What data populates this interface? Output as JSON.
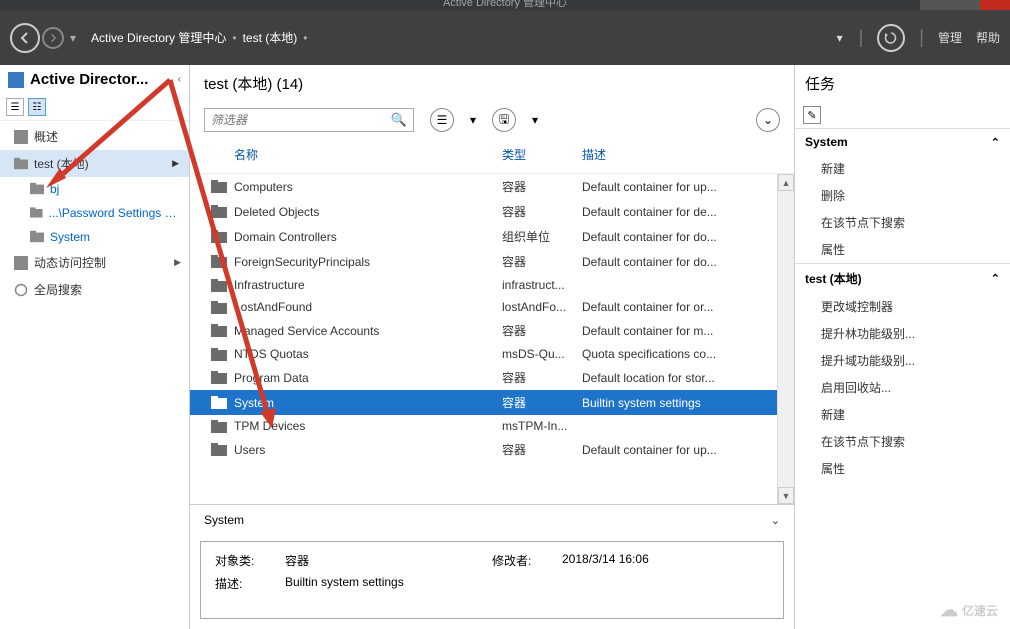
{
  "window_title": "Active Directory 管理中心",
  "header": {
    "breadcrumb": [
      "Active Directory 管理中心",
      "test (本地)"
    ],
    "manage": "管理",
    "help": "帮助"
  },
  "sidebar": {
    "title": "Active Director...",
    "items": [
      {
        "label": "概述",
        "plain": true
      },
      {
        "label": "test (本地)",
        "selected": true,
        "plain": true
      },
      {
        "label": "bj",
        "child": true
      },
      {
        "label": "...\\Password Settings Con...",
        "child": true,
        "truncate": true
      },
      {
        "label": "System",
        "child": true
      },
      {
        "label": "动态访问控制",
        "expandable": true,
        "plain": true
      },
      {
        "label": "全局搜索",
        "plain": true
      }
    ]
  },
  "center": {
    "title": "test (本地)  (14)",
    "filter_placeholder": "筛选器",
    "columns": {
      "name": "名称",
      "type": "类型",
      "desc": "描述"
    },
    "rows": [
      {
        "name": "Computers",
        "type": "容器",
        "desc": "Default container for up..."
      },
      {
        "name": "Deleted Objects",
        "type": "容器",
        "desc": "Default container for de..."
      },
      {
        "name": "Domain Controllers",
        "type": "组织单位",
        "desc": "Default container for do..."
      },
      {
        "name": "ForeignSecurityPrincipals",
        "type": "容器",
        "desc": "Default container for do..."
      },
      {
        "name": "Infrastructure",
        "type": "infrastruct...",
        "desc": ""
      },
      {
        "name": "LostAndFound",
        "type": "lostAndFo...",
        "desc": "Default container for or..."
      },
      {
        "name": "Managed Service Accounts",
        "type": "容器",
        "desc": "Default container for m..."
      },
      {
        "name": "NTDS Quotas",
        "type": "msDS-Qu...",
        "desc": "Quota specifications co..."
      },
      {
        "name": "Program Data",
        "type": "容器",
        "desc": "Default location for stor..."
      },
      {
        "name": "System",
        "type": "容器",
        "desc": "Builtin system settings",
        "selected": true
      },
      {
        "name": "TPM Devices",
        "type": "msTPM-In...",
        "desc": ""
      },
      {
        "name": "Users",
        "type": "容器",
        "desc": "Default container for up..."
      }
    ],
    "detail": {
      "title": "System",
      "class_label": "对象类:",
      "class_value": "容器",
      "modified_label": "修改者:",
      "modified_value": "2018/3/14 16:06",
      "desc_label": "描述:",
      "desc_value": "Builtin system settings"
    }
  },
  "tasks": {
    "title": "任务",
    "sections": [
      {
        "header": "System",
        "items": [
          "新建",
          "删除",
          "在该节点下搜索",
          "属性"
        ]
      },
      {
        "header": "test (本地)",
        "items": [
          "更改域控制器",
          "提升林功能级别...",
          "提升域功能级别...",
          "启用回收站...",
          "新建",
          "在该节点下搜索",
          "属性"
        ]
      }
    ]
  },
  "watermark": "亿速云"
}
